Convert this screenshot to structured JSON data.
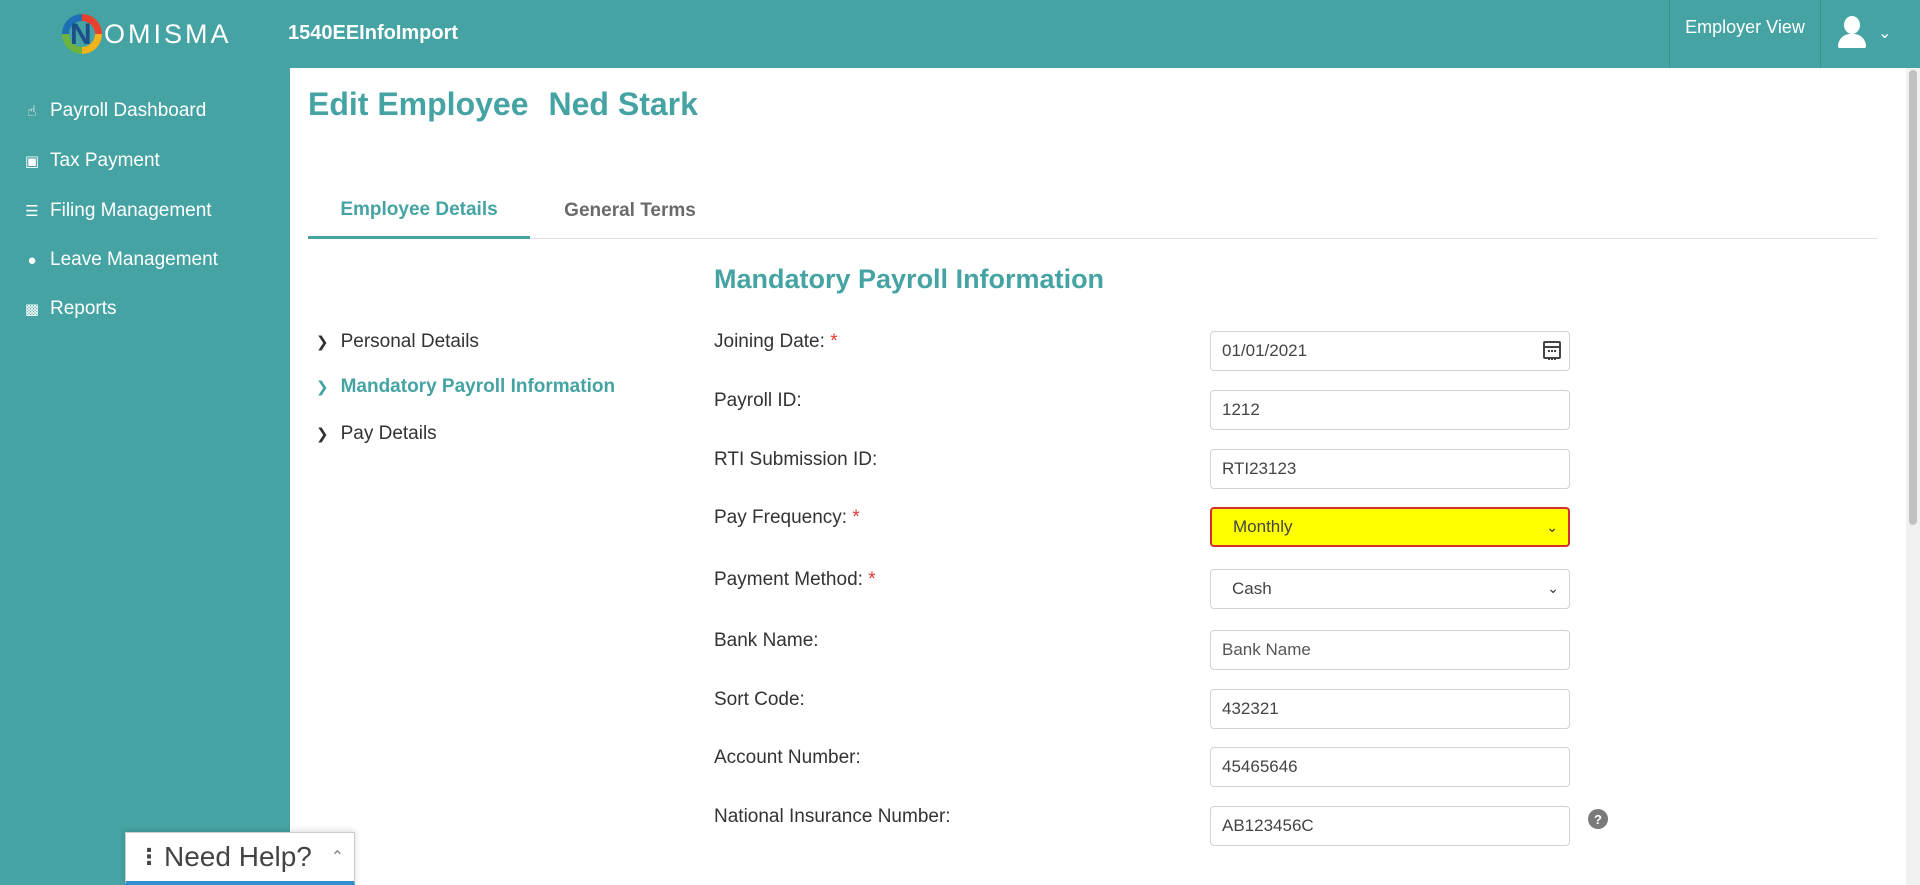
{
  "header": {
    "logo_text": "OMISMA",
    "logo_letter": "N",
    "app_name": "1540EEInfoImport",
    "employer_view": "Employer View"
  },
  "sidebar": {
    "items": [
      {
        "label": "Payroll Dashboard",
        "icon": "hand-pointer-icon"
      },
      {
        "label": "Tax Payment",
        "icon": "briefcase-icon"
      },
      {
        "label": "Filing Management",
        "icon": "document-icon"
      },
      {
        "label": "Leave Management",
        "icon": "globe-icon"
      },
      {
        "label": "Reports",
        "icon": "clipboard-icon"
      }
    ]
  },
  "page": {
    "title": "Edit Employee",
    "employee_name": "Ned Stark"
  },
  "tabs": [
    {
      "label": "Employee Details",
      "active": true
    },
    {
      "label": "General Terms",
      "active": false
    }
  ],
  "section_nav": [
    {
      "label": "Personal Details",
      "active": false
    },
    {
      "label": "Mandatory Payroll Information",
      "active": true
    },
    {
      "label": "Pay Details",
      "active": false
    }
  ],
  "form": {
    "section_title": "Mandatory Payroll Information",
    "joining_date": {
      "label": "Joining Date:",
      "required": "*",
      "value": "01/01/2021"
    },
    "payroll_id": {
      "label": "Payroll ID:",
      "value": "1212"
    },
    "rti_submission_id": {
      "label": "RTI Submission ID:",
      "value": "RTI23123"
    },
    "pay_frequency": {
      "label": "Pay Frequency:",
      "required": "*",
      "value": "Monthly"
    },
    "payment_method": {
      "label": "Payment Method:",
      "required": "*",
      "value": "Cash"
    },
    "bank_name": {
      "label": "Bank Name:",
      "placeholder": "Bank Name"
    },
    "sort_code": {
      "label": "Sort Code:",
      "value": "432321"
    },
    "account_number": {
      "label": "Account Number:",
      "value": "45465646"
    },
    "ni_number": {
      "label": "National Insurance Number:",
      "value": "AB123456C"
    }
  },
  "help_widget": {
    "label": "Need Help?"
  },
  "colors": {
    "brand_teal": "#45a3a3",
    "highlight_yellow": "#ffff00",
    "required_red": "#e53935"
  }
}
